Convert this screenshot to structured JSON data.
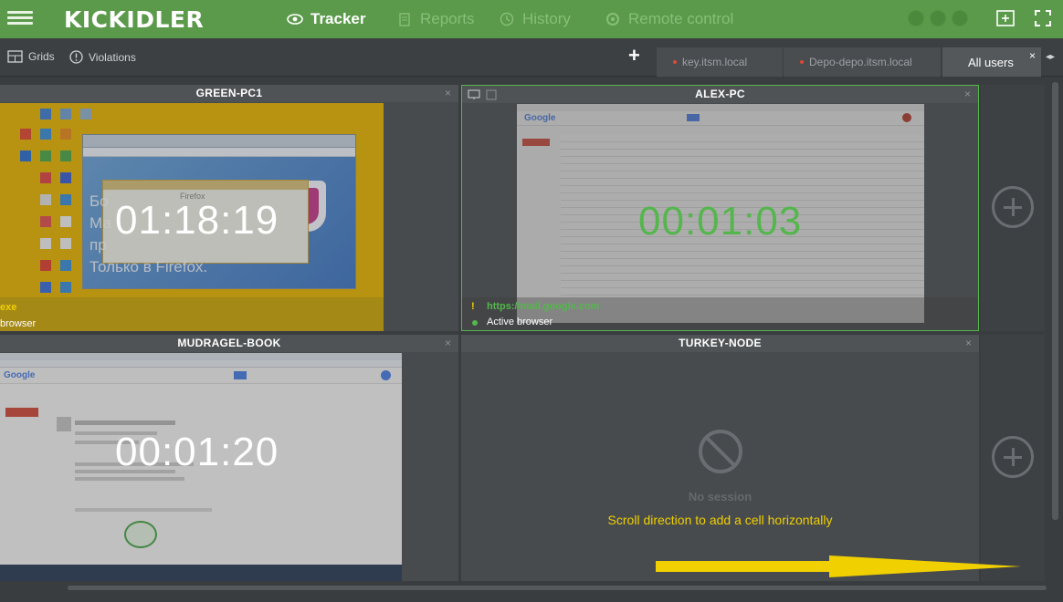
{
  "brand": {
    "logo": "KICKIDLER"
  },
  "nav": [
    {
      "label": "Tracker",
      "icon": "eye-icon",
      "active": true
    },
    {
      "label": "Reports",
      "icon": "document-icon",
      "active": false
    },
    {
      "label": "History",
      "icon": "history-icon",
      "active": false
    },
    {
      "label": "Remote control",
      "icon": "remote-icon",
      "active": false
    }
  ],
  "toolbar": {
    "grids": "Grids",
    "violations": "Violations"
  },
  "tabs": [
    {
      "label": "key.itsm.local",
      "active": false
    },
    {
      "label": "Depo-depo.itsm.local",
      "active": false
    },
    {
      "label": "All users",
      "active": true
    }
  ],
  "tab_close": "×",
  "cells": [
    {
      "name": "GREEN-PC1",
      "timer": "01:18:19",
      "status_line1": "exe",
      "status_line2": "browser",
      "overlay_text": [
        "Бо",
        "Ма",
        "пр",
        "Только в Firefox."
      ],
      "window_title": "Firefox"
    },
    {
      "name": "ALEX-PC",
      "timer": "00:01:03",
      "url": "https://mail.google.com",
      "status": "Active browser",
      "url_marker": "!"
    },
    {
      "name": "MUDRAGEL-BOOK",
      "timer": "00:01:20"
    },
    {
      "name": "TURKEY-NODE",
      "no_session": "No session",
      "hint": "Scroll direction to add a cell horizontally"
    }
  ],
  "colors": {
    "topbar": "#5a9a4a",
    "accent_green": "#55b64d",
    "hint_yellow": "#f0d000"
  }
}
